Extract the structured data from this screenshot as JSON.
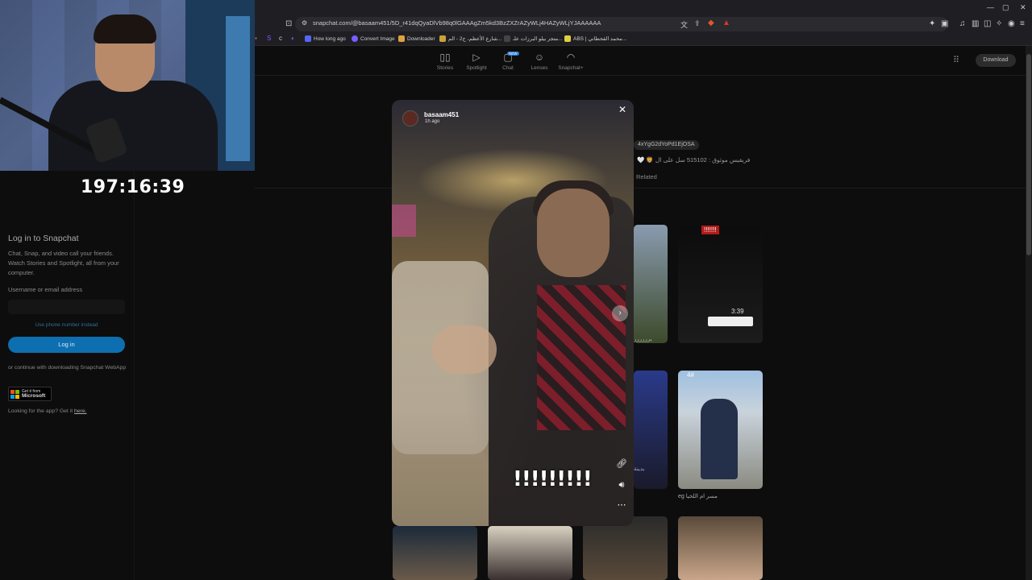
{
  "stream": {
    "timer": "197:16:39"
  },
  "browser": {
    "url": "snapchat.com/@basaam451/5D_r41dqQyaDlVb98q0lGAAAgZm5kd3BzZXZrAZyWLj4HAZyWLjYJAAAAAA",
    "bookmarks": [
      {
        "label": "How long ago",
        "color": "#5865f2"
      },
      {
        "label": "Convert Image",
        "color": "#7b5cff"
      },
      {
        "label": "Downloader",
        "color": "#e0a040"
      },
      {
        "label": "شارع الأعظم، ج2 - الم...",
        "color": "#c9a23a"
      },
      {
        "label": "متجر بيلو البرزات علـ...",
        "color": "#444"
      },
      {
        "label": "ABS | محمد القحطاني...",
        "color": "#e0d040"
      }
    ],
    "window_controls": [
      "—",
      "▢",
      "✕"
    ]
  },
  "snapchat": {
    "nav": [
      {
        "label": "Stories",
        "icon": "stories-icon"
      },
      {
        "label": "Spotlight",
        "icon": "spotlight-icon"
      },
      {
        "label": "Chat",
        "icon": "chat-icon",
        "badge": "NEW"
      },
      {
        "label": "Lenses",
        "icon": "lenses-icon"
      },
      {
        "label": "Snapchat+",
        "icon": "ghost-icon"
      }
    ],
    "download_label": "Download",
    "login": {
      "title": "Log in to Snapchat",
      "description": "Chat, Snap, and video call your friends. Watch Stories and Spotlight, all from your computer.",
      "username_label": "Username or email address",
      "username_placeholder": "",
      "phone_link": "Use phone number instead",
      "login_button": "Log in",
      "continue_text": "or continue with downloading Snapchat WebApp",
      "ms_small": "Get it from",
      "ms_big": "Microsoft",
      "app_text": "Looking for the app? Get it",
      "app_link": "here."
    },
    "profile": {
      "handle_tag": "4xYgG2dYoPd1EjOSA",
      "bio": "🤍 🦁 فريقيس موثوق : 515102 سل على ال",
      "tab_related": "Related"
    },
    "tiles": {
      "t1_caption": "!!!!!!!",
      "t1_time": "3:39",
      "t2_tag": "4#",
      "t2_caption": "eg مسر ام اللخيا",
      "t_left_caption": "يرررررر",
      "t_mid_caption": "بدينة"
    },
    "story": {
      "username": "basaam451",
      "time_ago": "1h ago",
      "caption": "!!!!!!!!!",
      "close": "✕",
      "next": "›"
    }
  }
}
